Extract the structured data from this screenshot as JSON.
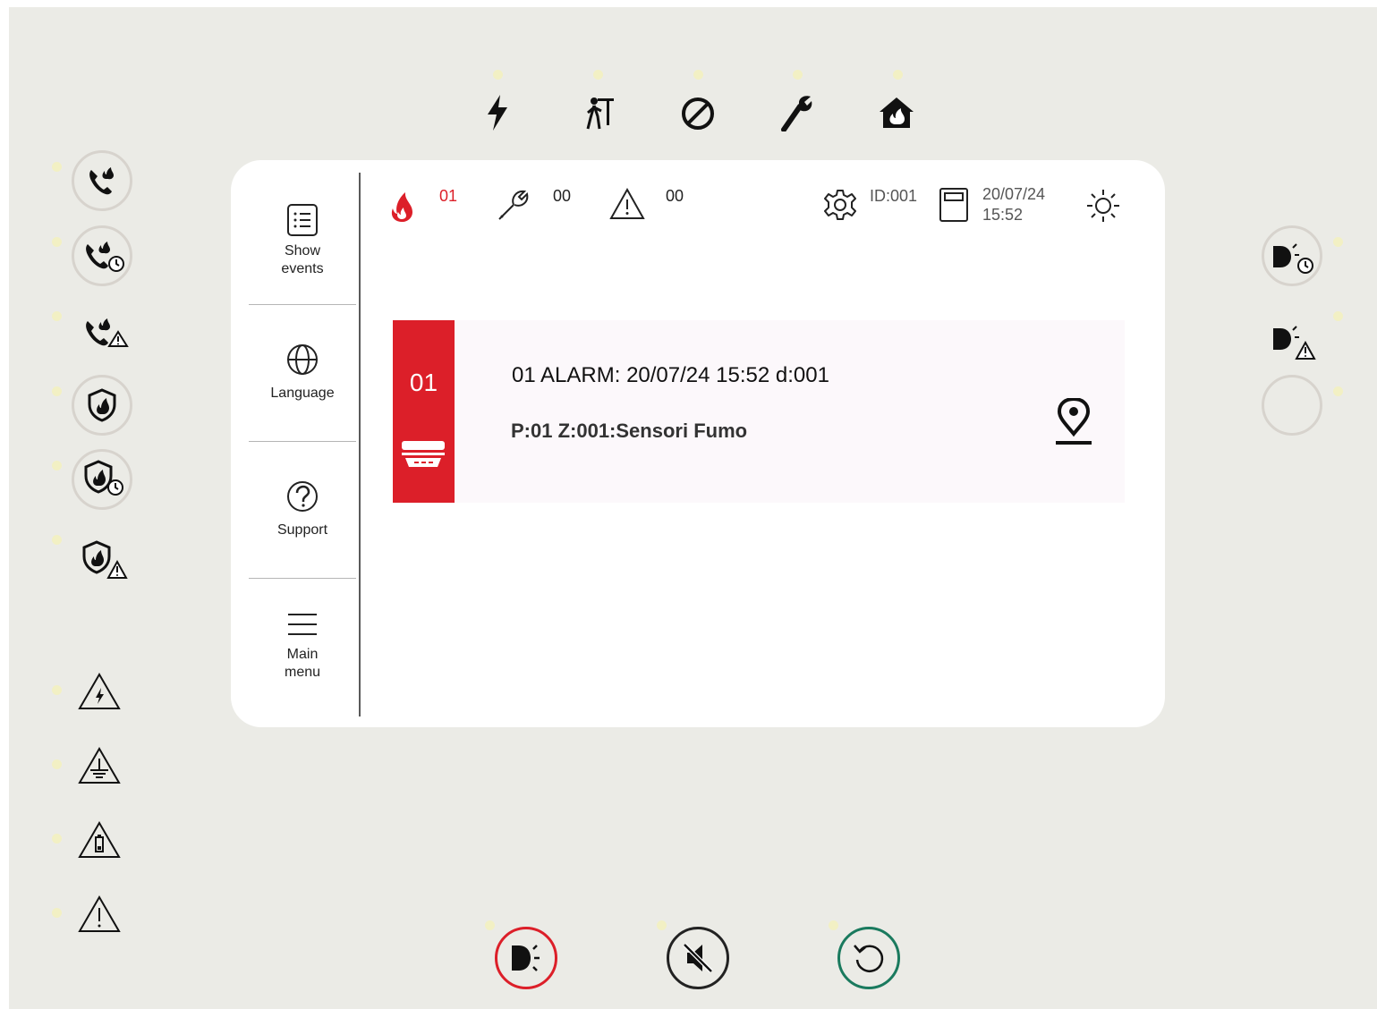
{
  "sidebar": {
    "items": [
      {
        "label": "Show events",
        "icon": "list-icon"
      },
      {
        "label": "Language",
        "icon": "globe-icon"
      },
      {
        "label": "Support",
        "icon": "question-icon"
      },
      {
        "label": "Main menu",
        "icon": "hamburger-icon"
      }
    ]
  },
  "status_bar": {
    "fire_count": "01",
    "fault_count": "00",
    "warning_count": "00",
    "panel_id": "ID:001",
    "date": "20/07/24",
    "time": "15:52"
  },
  "event": {
    "badge_number": "01",
    "title": "01 ALARM: 20/07/24 15:52 d:001",
    "detail": "P:01 Z:001:Sensori Fumo"
  },
  "top_indicators": [
    "power-icon",
    "evacuation-icon",
    "disabled-icon",
    "maintenance-icon",
    "fire-house-icon"
  ],
  "left_indicators": [
    "phone-fire-icon",
    "phone-fire-delay-icon",
    "phone-fire-fault-icon",
    "fire-protection-icon",
    "fire-protection-delay-icon",
    "fire-protection-fault-icon",
    "power-fault-icon",
    "earth-fault-icon",
    "battery-fault-icon",
    "general-fault-icon"
  ],
  "right_indicators": [
    "siren-delay-icon",
    "siren-fault-icon",
    "blank-indicator"
  ],
  "bottom_buttons": [
    "evacuate-button",
    "silence-button",
    "reset-button"
  ],
  "colors": {
    "alarm_red": "#dc1f29",
    "reset_green": "#1a7a5e",
    "panel_bg": "#ebebe6",
    "led_yellow": "#f2f0c4"
  }
}
